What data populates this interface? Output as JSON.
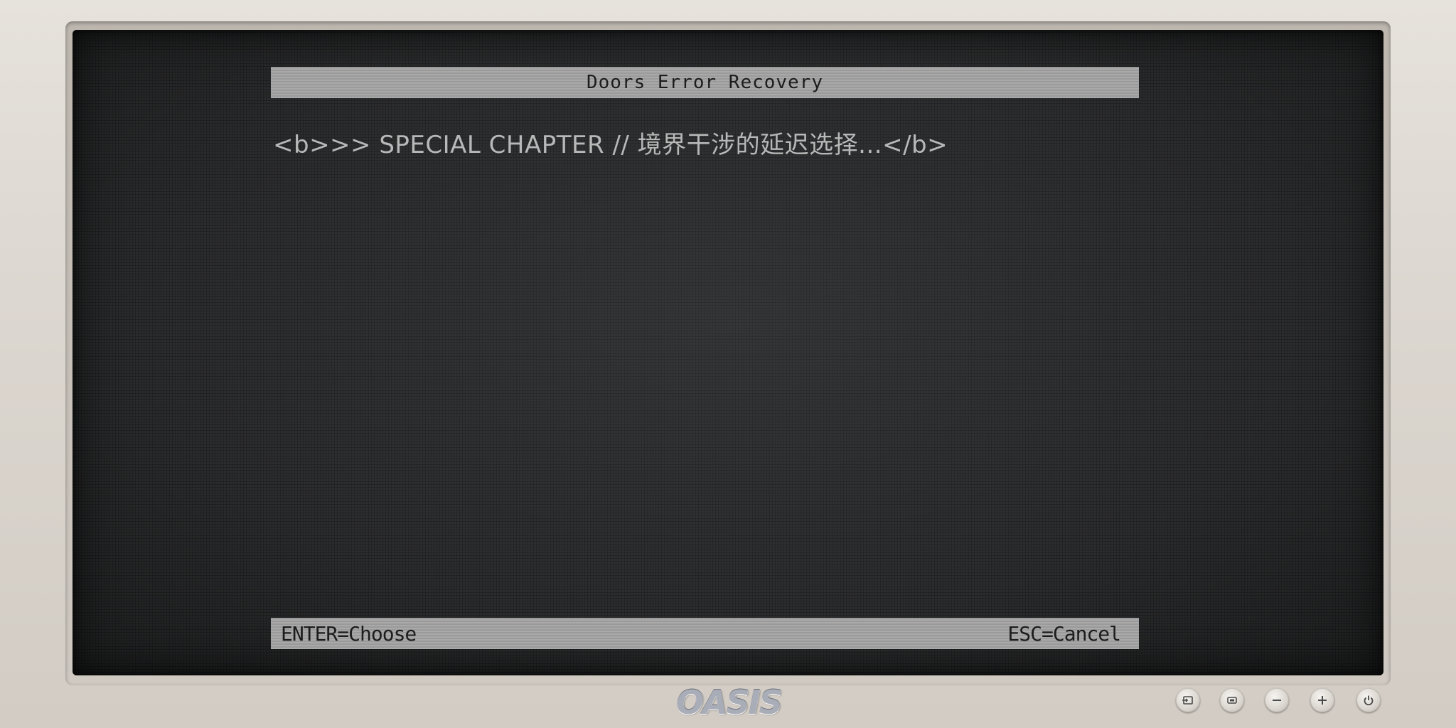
{
  "window": {
    "title": "Doors Error Recovery"
  },
  "main": {
    "chapter_line": "<b>>> SPECIAL CHAPTER // 境界干涉的延迟选择...</b>"
  },
  "footer": {
    "enter_hint": "ENTER=Choose",
    "esc_hint": "ESC=Cancel"
  },
  "monitor": {
    "brand": "OASIS",
    "buttons": [
      {
        "name": "input-source",
        "icon": "input-source-icon"
      },
      {
        "name": "menu",
        "icon": "menu-icon"
      },
      {
        "name": "minus",
        "icon": "minus-icon"
      },
      {
        "name": "plus",
        "icon": "plus-icon"
      },
      {
        "name": "power",
        "icon": "power-icon"
      }
    ]
  },
  "colors": {
    "screen_background": "#2b2c2d",
    "bar_background": "#a9a9a9",
    "bar_text": "#1c1c1c",
    "chapter_text": "#b8b8b8",
    "bezel": "#dcd7d0"
  }
}
